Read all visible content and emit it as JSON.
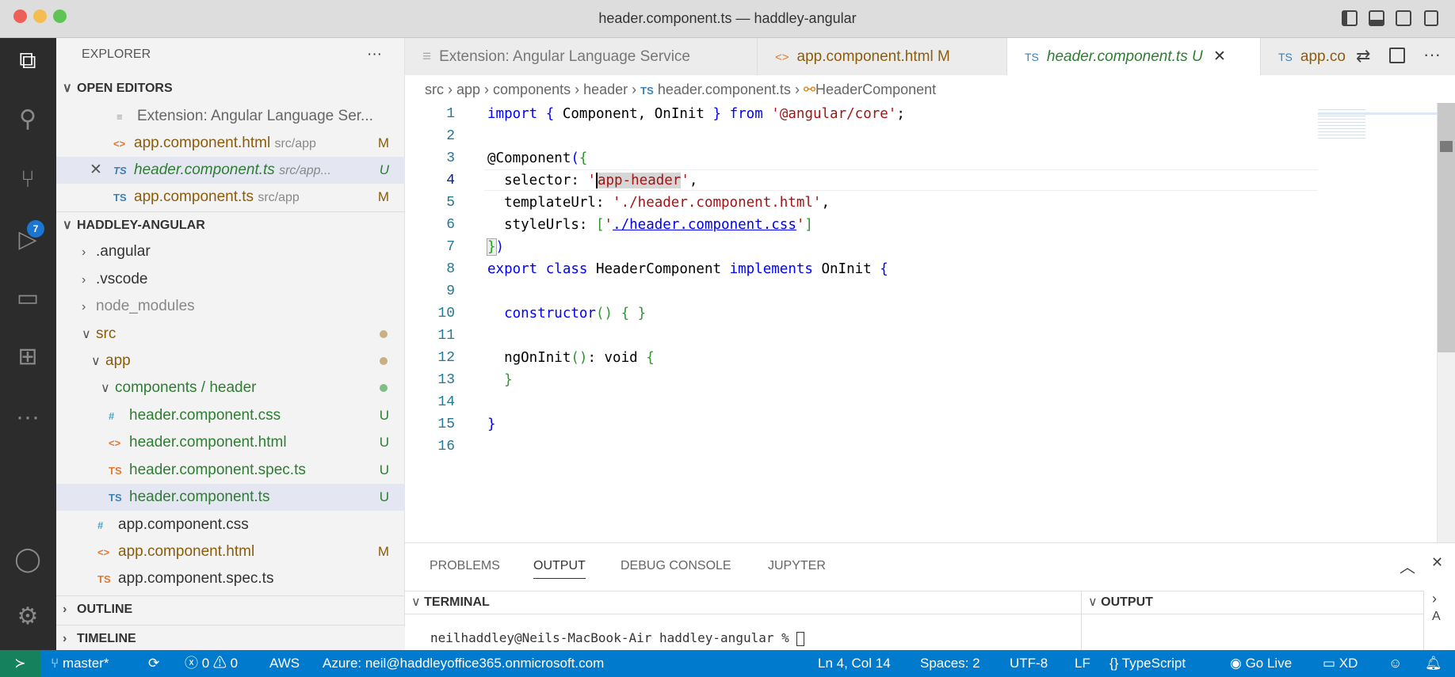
{
  "window": {
    "title": "header.component.ts — haddley-angular"
  },
  "activity": {
    "source_control_badge": "7"
  },
  "sidebar": {
    "title": "EXPLORER",
    "more": "···",
    "open_editors": {
      "label": "OPEN EDITORS",
      "items": [
        {
          "icon": "TS",
          "name": "Extension: Angular Language Ser...",
          "path": "",
          "status": ""
        },
        {
          "icon": "<>",
          "name": "app.component.html",
          "path": "src/app",
          "status": "M"
        },
        {
          "icon": "TS",
          "name": "header.component.ts",
          "path": "src/app...",
          "status": "U"
        },
        {
          "icon": "TS",
          "name": "app.component.ts",
          "path": "src/app",
          "status": "M"
        }
      ]
    },
    "project": {
      "label": "HADDLEY-ANGULAR",
      "items": [
        {
          "name": ".angular"
        },
        {
          "name": ".vscode"
        },
        {
          "name": "node_modules"
        },
        {
          "name": "src"
        },
        {
          "name": "app"
        },
        {
          "name": "components / header"
        },
        {
          "icon": "#",
          "name": "header.component.css",
          "status": "U"
        },
        {
          "icon": "<>",
          "name": "header.component.html",
          "status": "U"
        },
        {
          "icon": "TS",
          "name": "header.component.spec.ts",
          "status": "U"
        },
        {
          "icon": "TS",
          "name": "header.component.ts",
          "status": "U"
        },
        {
          "icon": "#",
          "name": "app.component.css",
          "status": ""
        },
        {
          "icon": "<>",
          "name": "app.component.html",
          "status": "M"
        },
        {
          "icon": "TS",
          "name": "app.component.spec.ts",
          "status": ""
        }
      ]
    },
    "outline": "OUTLINE",
    "timeline": "TIMELINE"
  },
  "tabs": [
    {
      "icon": "≡",
      "label": "Extension: Angular Language Service",
      "status": ""
    },
    {
      "icon": "<>",
      "label": "app.component.html",
      "status": "M"
    },
    {
      "icon": "TS",
      "label": "header.component.ts",
      "status": "U",
      "close": "✕"
    },
    {
      "icon": "TS",
      "label": "app.co"
    }
  ],
  "breadcrumb": [
    "src",
    "app",
    "components",
    "header",
    "header.component.ts",
    "HeaderComponent"
  ],
  "ts_icon": "TS",
  "panel": {
    "tabs": [
      "PROBLEMS",
      "OUTPUT",
      "DEBUG CONSOLE",
      "JUPYTER"
    ],
    "terminal": "TERMINAL",
    "output": "OUTPUT",
    "prompt": "neilhaddley@Neils-MacBook-Air haddley-angular % "
  },
  "status": {
    "branch": "master*",
    "errors": "0",
    "warnings": "0",
    "aws": "AWS",
    "azure": "Azure: neil@haddleyoffice365.onmicrosoft.com",
    "position": "Ln 4, Col 14",
    "spaces": "Spaces: 2",
    "encoding": "UTF-8",
    "eol": "LF",
    "language": "TypeScript",
    "golive": "Go Live",
    "xd": "XD"
  }
}
